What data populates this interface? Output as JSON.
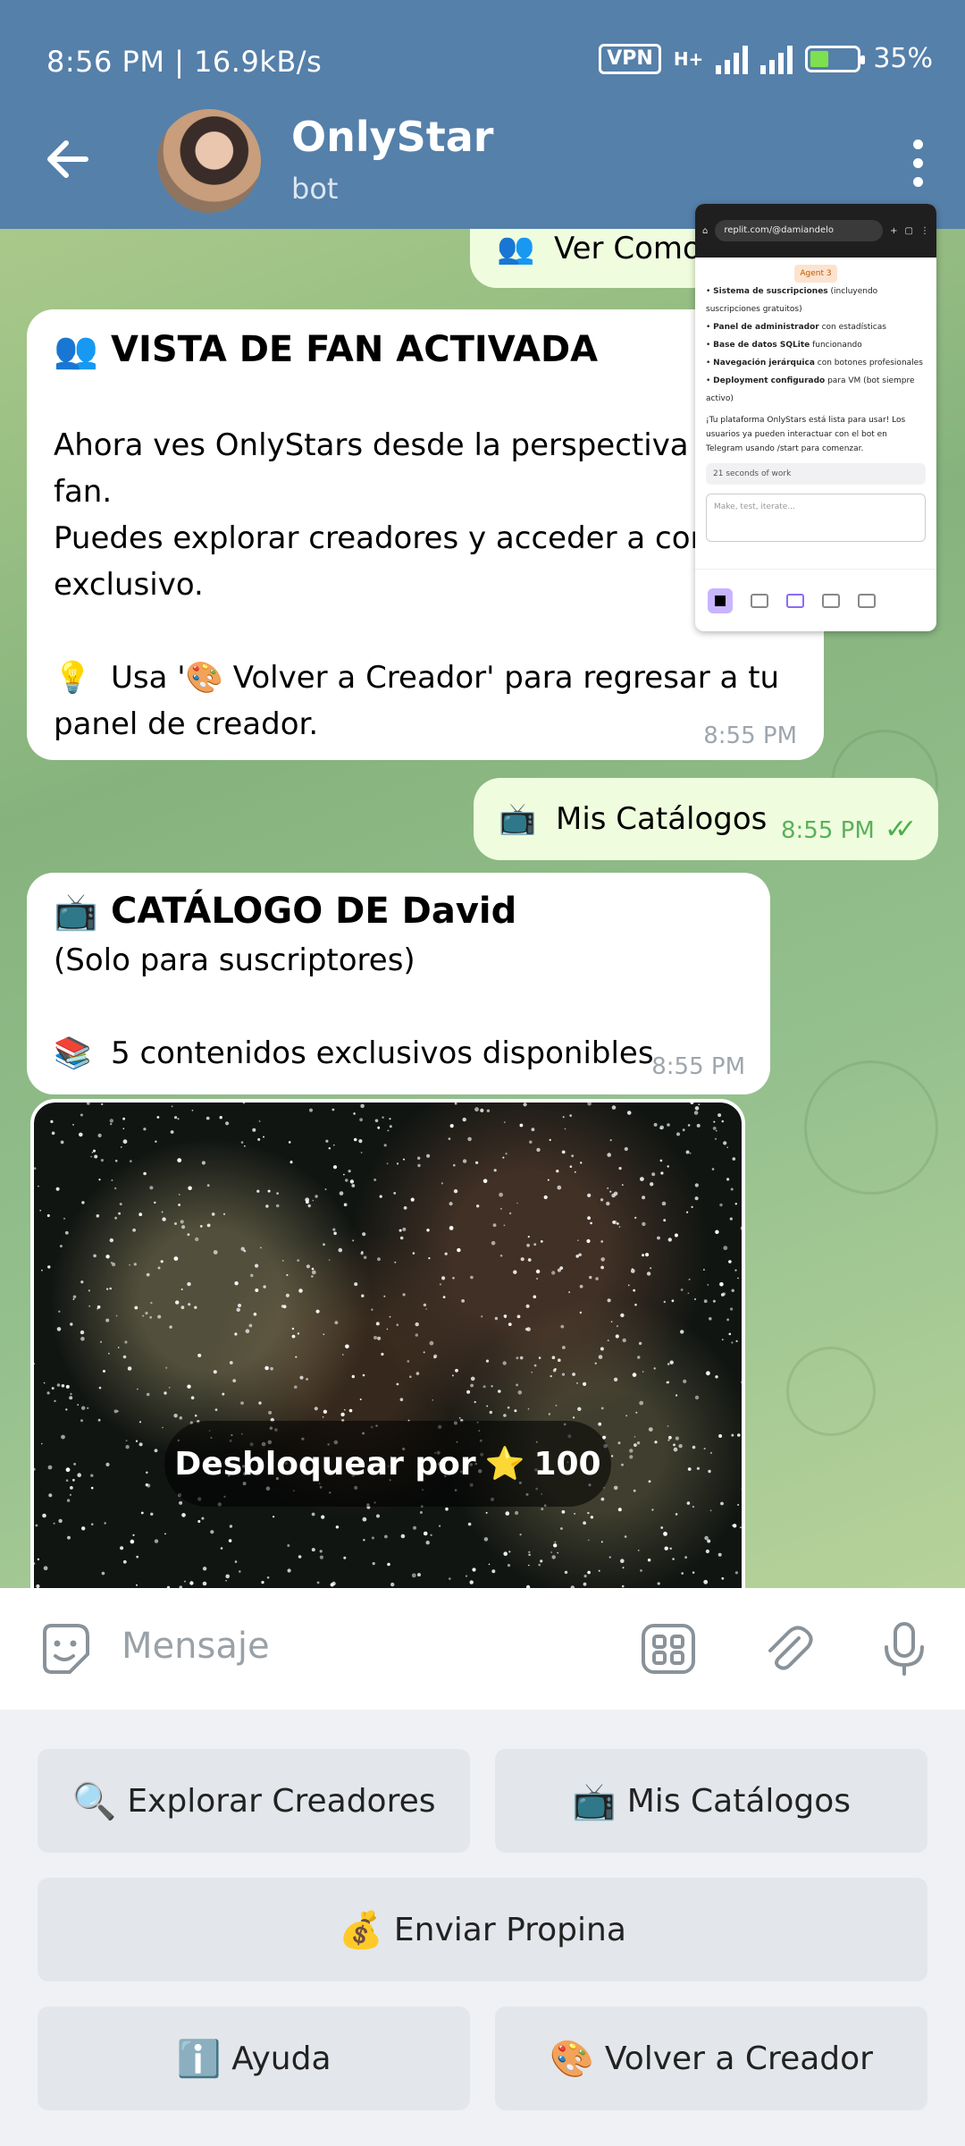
{
  "status_bar": {
    "time_speed": "8:56 PM | 16.9kB/s",
    "vpn": "VPN",
    "network": "H+",
    "battery": "35%"
  },
  "header": {
    "title": "OnlyStar",
    "subtitle": "bot"
  },
  "messages": {
    "ver_como": {
      "emoji": "👥",
      "text": "Ver Como"
    },
    "fan_view": {
      "heading_emoji": "👥",
      "heading": "VISTA DE FAN ACTIVADA",
      "line1": "Ahora ves OnlyStars desde la perspectiva",
      "line2": "fan.",
      "line3": "Puedes explorar creadores y acceder a con",
      "line4": "exclusivo.",
      "tip_emoji": "💡",
      "tip_line1": "Usa '🎨 Volver a Creador' para regresar a tu",
      "tip_line2": "panel de creador.",
      "time": "8:55 PM"
    },
    "mis_catalogos": {
      "emoji": "📺",
      "text": "Mis Catálogos",
      "time": "8:55 PM",
      "ticks": "✓✓"
    },
    "catalog": {
      "heading_emoji": "📺",
      "heading": "CATÁLOGO DE David",
      "subheading": "(Solo para suscriptores)",
      "count_emoji": "📚",
      "count_text": "5 contenidos exclusivos disponibles",
      "time": "8:55 PM"
    },
    "media": {
      "unlock_label": "Desbloquear por",
      "star": "⭐",
      "price": "100"
    }
  },
  "pip": {
    "url": "replit.com/@damiandelo",
    "agent": "Agent 3",
    "lines": [
      {
        "bold": "Sistema de suscripciones",
        "rest": " (incluyendo suscripciones gratuitos)"
      },
      {
        "bold": "Panel de administrador",
        "rest": " con estadísticas"
      },
      {
        "bold": "Base de datos SQLite",
        "rest": " funcionando"
      },
      {
        "bold": "Navegación jerárquica",
        "rest": " con botones profesionales"
      },
      {
        "bold": "Deployment configurado",
        "rest": " para VM (bot siempre activo)"
      }
    ],
    "summary": "¡Tu plataforma OnlyStars está lista para usar! Los usuarios ya pueden interactuar con el bot en Telegram usando /start para comenzar.",
    "work": "21 seconds of work",
    "input_placeholder": "Make, test, iterate..."
  },
  "input": {
    "placeholder": "Mensaje"
  },
  "keyboard": {
    "explorar": {
      "emoji": "🔍",
      "label": "Explorar Creadores"
    },
    "catalogos": {
      "emoji": "📺",
      "label": "Mis Catálogos"
    },
    "propina": {
      "emoji": "💰",
      "label": "Enviar Propina"
    },
    "ayuda": {
      "emoji": "ℹ️",
      "label": "Ayuda"
    },
    "volver": {
      "emoji": "🎨",
      "label": "Volver a Creador"
    }
  }
}
